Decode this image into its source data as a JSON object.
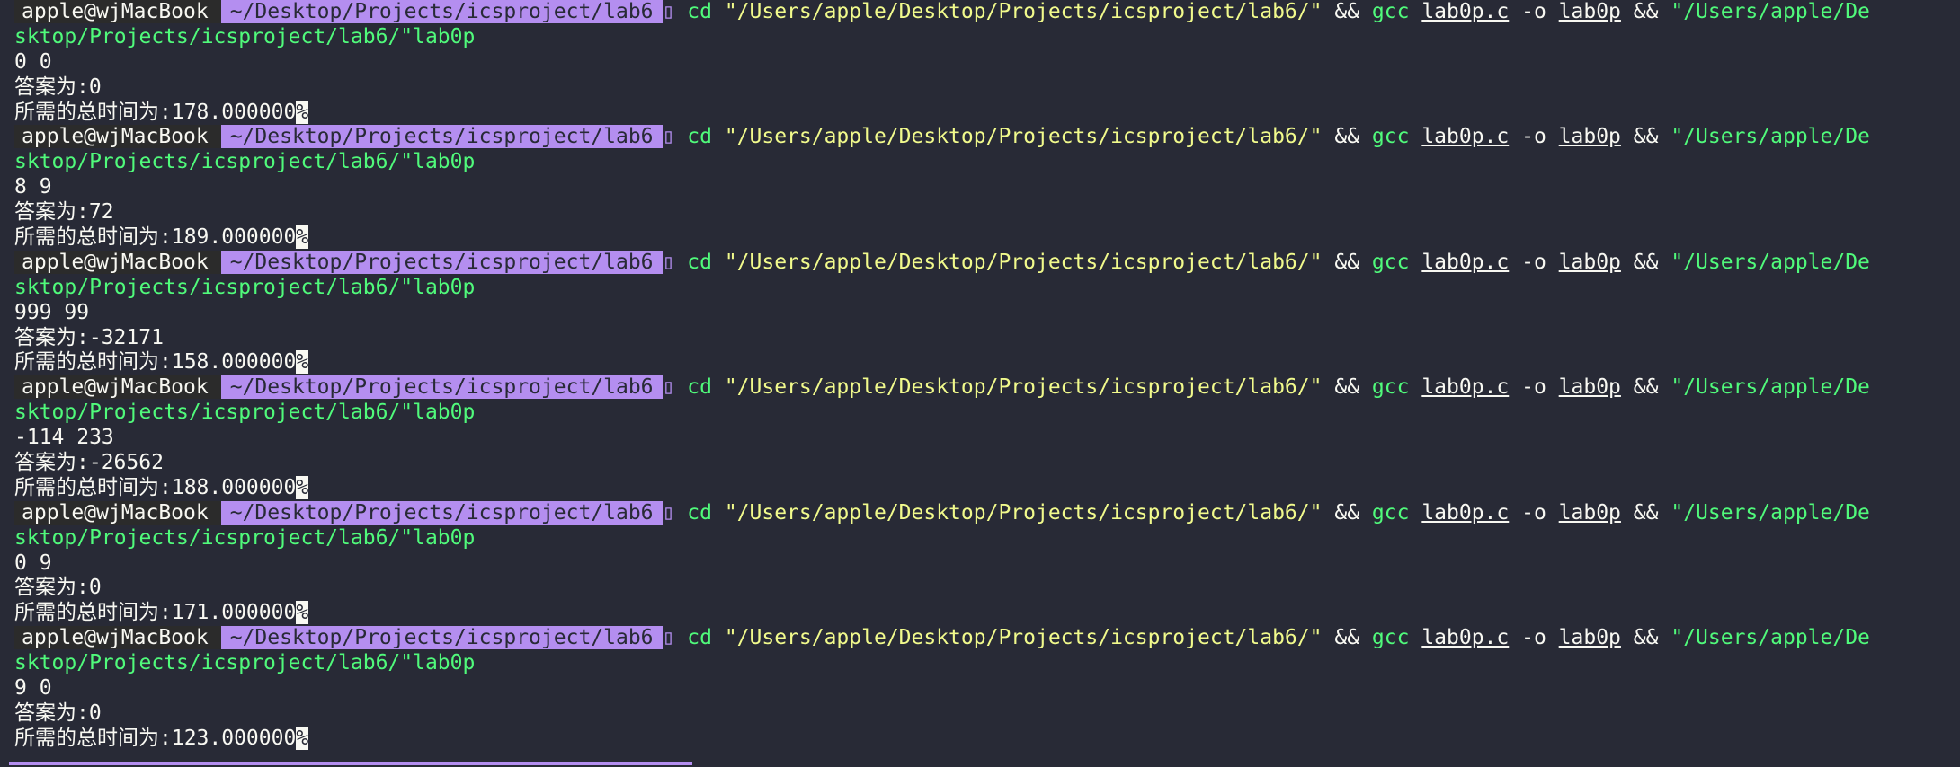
{
  "prompt": {
    "user_host": "apple@wjMacBook",
    "path": "~/Desktop/Projects/icsproject/lab6",
    "separator": "▯"
  },
  "command": {
    "cd": "cd",
    "dir": "\"/Users/apple/Desktop/Projects/icsproject/lab6/\"",
    "and1": "&&",
    "gcc": "gcc",
    "src": "lab0p.c",
    "flag": "-o",
    "out": "lab0p",
    "and2": "&&",
    "run_part1": "\"/Users/apple/De",
    "run_part2": "sktop/Projects/icsproject/lab6/\"lab0p"
  },
  "percent_mark": "%",
  "runs": [
    {
      "input": "0 0",
      "answer": "答案为:0",
      "time": "所需的总时间为:178.000000"
    },
    {
      "input": "8 9",
      "answer": "答案为:72",
      "time": "所需的总时间为:189.000000"
    },
    {
      "input": "999 99",
      "answer": "答案为:-32171",
      "time": "所需的总时间为:158.000000"
    },
    {
      "input": "-114 233",
      "answer": "答案为:-26562",
      "time": "所需的总时间为:188.000000"
    },
    {
      "input": "0 9",
      "answer": "答案为:0",
      "time": "所需的总时间为:171.000000"
    },
    {
      "input": "9 0",
      "answer": "答案为:0",
      "time": "所需的总时间为:123.000000"
    }
  ]
}
